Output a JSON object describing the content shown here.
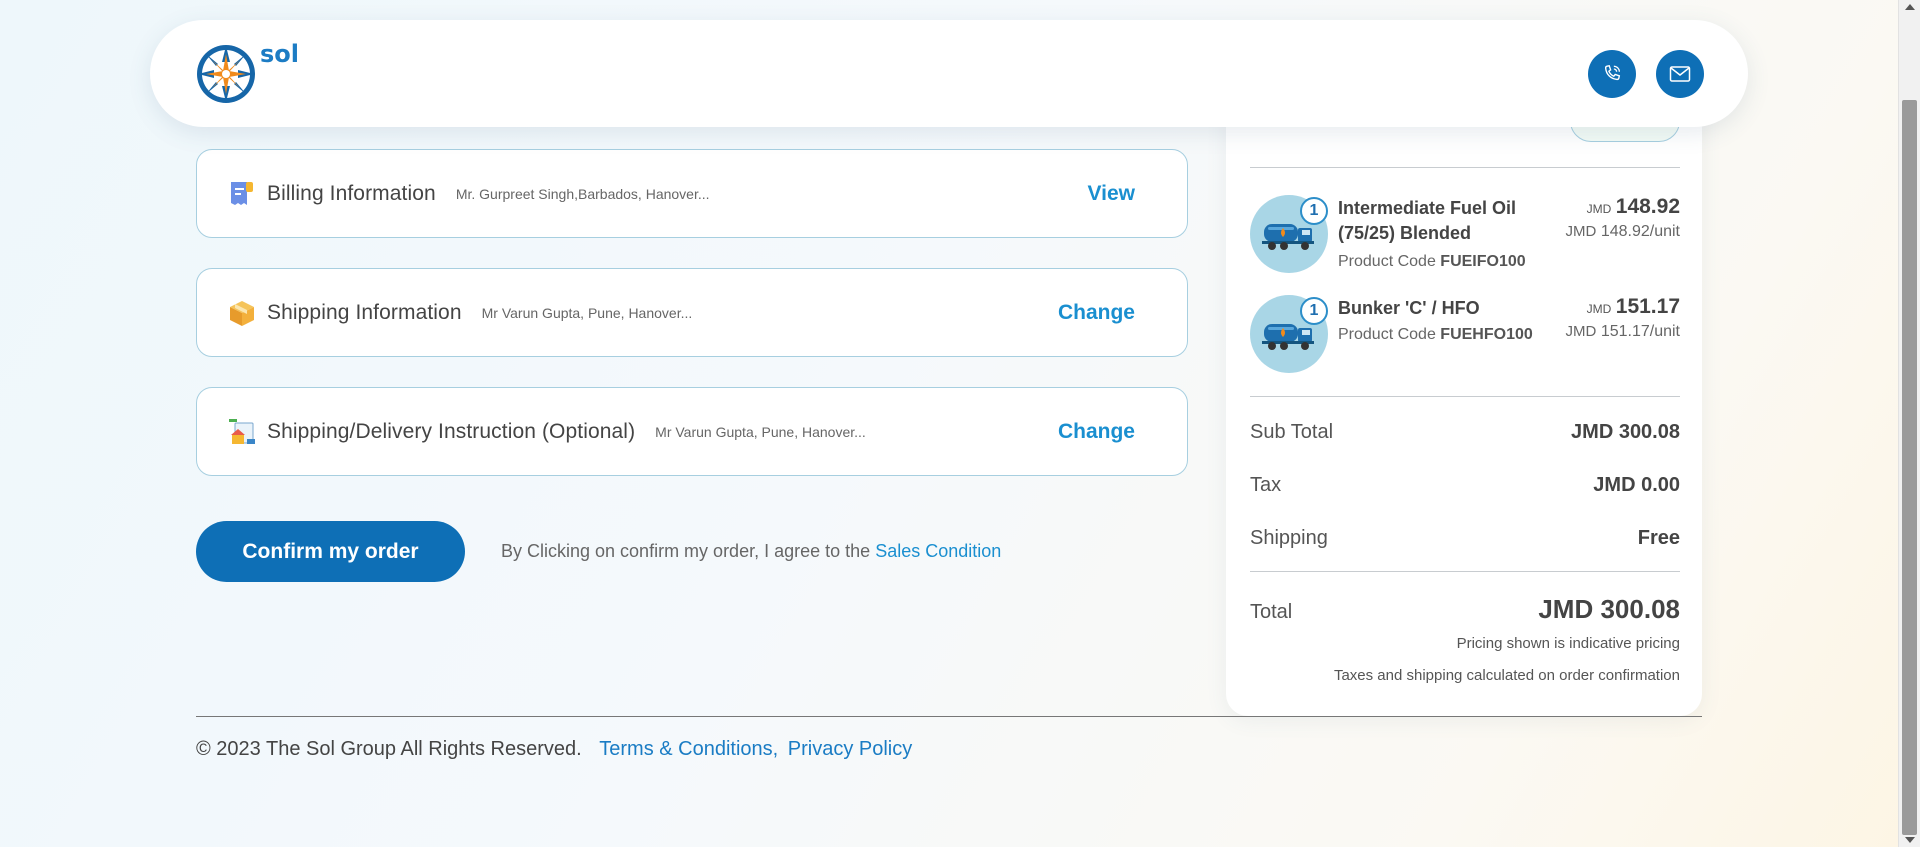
{
  "header": {
    "logo_text": "sol",
    "phone_icon": "phone-icon",
    "mail_icon": "mail-icon"
  },
  "cards": [
    {
      "title": "Billing Information",
      "summary": "Mr. Gurpreet Singh,Barbados, Hanover...",
      "action": "View",
      "icon": "receipt-icon"
    },
    {
      "title": "Shipping Information",
      "summary": "Mr Varun Gupta, Pune, Hanover...",
      "action": "Change",
      "icon": "package-icon"
    },
    {
      "title": "Shipping/Delivery Instruction (Optional)",
      "summary": "Mr Varun Gupta, Pune, Hanover...",
      "action": "Change",
      "icon": "delivery-icon"
    }
  ],
  "confirm": {
    "button_label": "Confirm my order",
    "agree_text": "By Clicking on confirm my order, I agree to the",
    "agree_link": "Sales Condition"
  },
  "summary": {
    "items": [
      {
        "qty": "1",
        "name": "Intermediate Fuel Oil (75/25) Blended",
        "code_label": "Product Code",
        "code": "FUEIFO100",
        "currency": "JMD",
        "price": "148.92",
        "unit_currency": "JMD",
        "unit_price": "148.92/unit"
      },
      {
        "qty": "1",
        "name": "Bunker 'C' / HFO",
        "code_label": "Product Code",
        "code": "FUEHFO100",
        "currency": "JMD",
        "price": "151.17",
        "unit_currency": "JMD",
        "unit_price": "151.17/unit"
      }
    ],
    "subtotal_label": "Sub Total",
    "subtotal": "JMD 300.08",
    "tax_label": "Tax",
    "tax": "JMD 0.00",
    "shipping_label": "Shipping",
    "shipping": "Free",
    "total_label": "Total",
    "total": "JMD 300.08",
    "note_1": "Pricing shown is indicative pricing",
    "note_2": "Taxes and shipping calculated on order confirmation"
  },
  "footer": {
    "copyright": "© 2023 The Sol Group All Rights Reserved.",
    "terms": "Terms & Conditions,",
    "privacy": "Privacy Policy"
  },
  "colors": {
    "brand_blue": "#0e6fb6",
    "link_blue": "#1a8fd0",
    "logo_orange": "#f08a1c"
  }
}
